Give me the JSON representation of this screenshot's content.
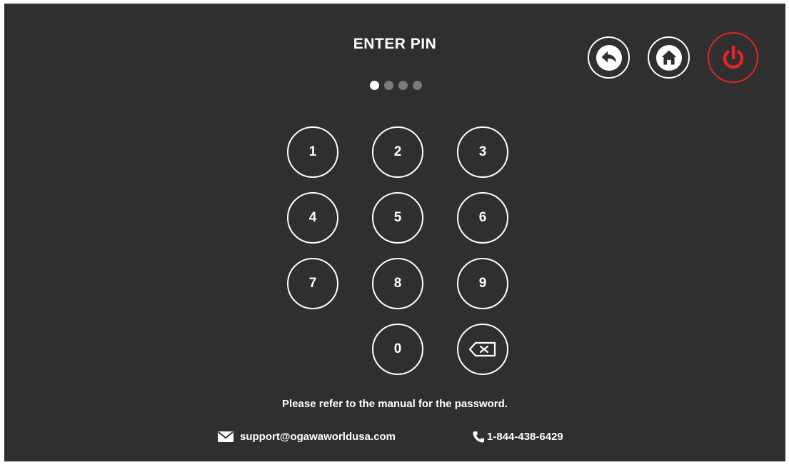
{
  "header": {
    "title": "ENTER PIN",
    "pin_length": 4,
    "digits_entered": 1
  },
  "nav": {
    "back_icon": "back-arrow-icon",
    "home_icon": "home-icon",
    "power_icon": "power-icon",
    "power_color": "#e0262b"
  },
  "keypad": {
    "k1": "1",
    "k2": "2",
    "k3": "3",
    "k4": "4",
    "k5": "5",
    "k6": "6",
    "k7": "7",
    "k8": "8",
    "k9": "9",
    "k0": "0",
    "backspace_icon": "backspace-icon"
  },
  "footer": {
    "hint": "Please refer to the manual for the password.",
    "email": "support@ogawaworldusa.com",
    "phone": "1-844-438-6429",
    "email_icon": "envelope-icon",
    "phone_icon": "phone-icon"
  },
  "colors": {
    "background": "#2f2f2f",
    "foreground": "#ffffff",
    "dot_empty": "#7a7a7a",
    "accent": "#e0262b"
  }
}
